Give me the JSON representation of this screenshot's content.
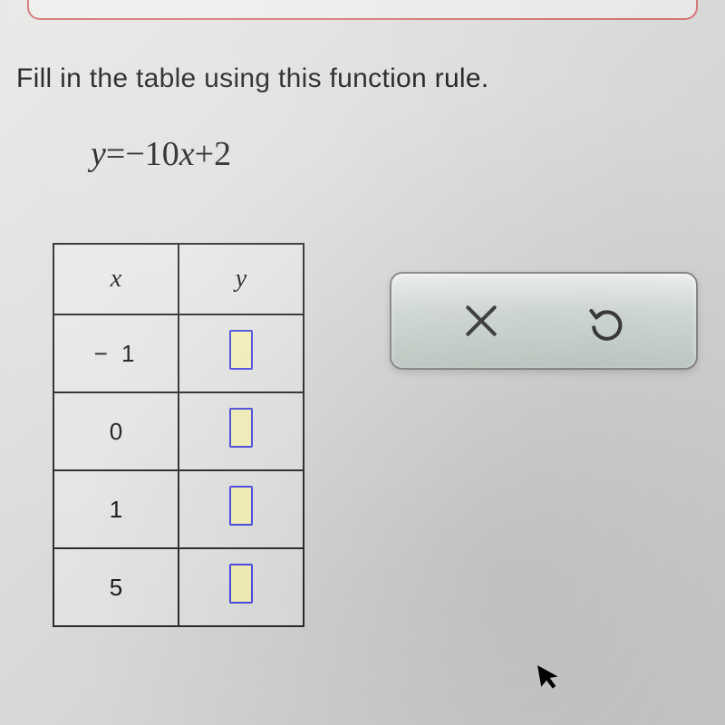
{
  "instruction": "Fill in the table using this function rule.",
  "equation": {
    "lhs_var": "y",
    "eq": "=",
    "coef_sign": "−",
    "coef": "10",
    "rhs_var": "x",
    "op": "+",
    "const": "2"
  },
  "table": {
    "header_x": "x",
    "header_y": "y",
    "rows": [
      {
        "x": "− 1",
        "y": ""
      },
      {
        "x": "0",
        "y": ""
      },
      {
        "x": "1",
        "y": ""
      },
      {
        "x": "5",
        "y": ""
      }
    ]
  },
  "toolbar": {
    "clear_label": "clear",
    "undo_label": "undo"
  },
  "chart_data": {
    "type": "table",
    "title": "Fill in the table using this function rule.",
    "function": "y = -10x + 2",
    "columns": [
      "x",
      "y"
    ],
    "rows": [
      {
        "x": -1,
        "y": null
      },
      {
        "x": 0,
        "y": null
      },
      {
        "x": 1,
        "y": null
      },
      {
        "x": 5,
        "y": null
      }
    ],
    "note": "y cells are empty input fields awaiting user entry"
  }
}
